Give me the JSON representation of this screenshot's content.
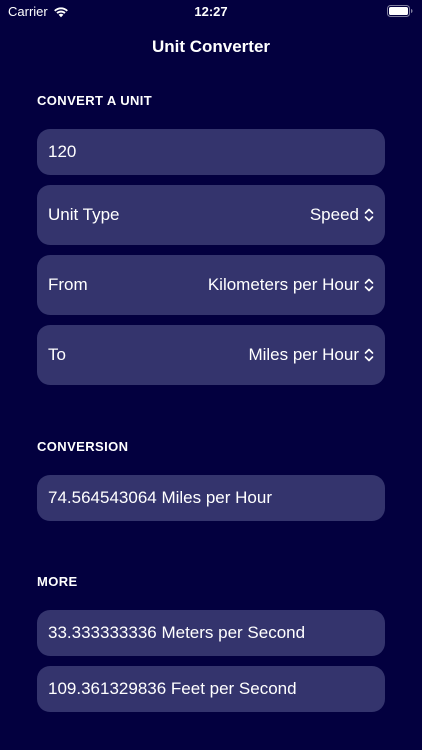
{
  "status_bar": {
    "carrier": "Carrier",
    "time": "12:27",
    "icons": [
      "wifi-icon",
      "battery-icon"
    ]
  },
  "nav": {
    "title": "Unit Converter"
  },
  "convert_section": {
    "header": "CONVERT A UNIT",
    "input_value": "120",
    "unit_type": {
      "label": "Unit Type",
      "value": "Speed"
    },
    "from": {
      "label": "From",
      "value": "Kilometers per Hour"
    },
    "to": {
      "label": "To",
      "value": "Miles per Hour"
    },
    "picker_icon": "chevron-up-down-icon"
  },
  "conversion_section": {
    "header": "CONVERSION",
    "result": "74.564543064 Miles per Hour"
  },
  "more_section": {
    "header": "MORE",
    "items": [
      "33.333333336 Meters per Second",
      "109.361329836 Feet per Second"
    ]
  },
  "colors": {
    "background": "#03003f",
    "row_background": "#34346d",
    "text": "#ffffff"
  }
}
